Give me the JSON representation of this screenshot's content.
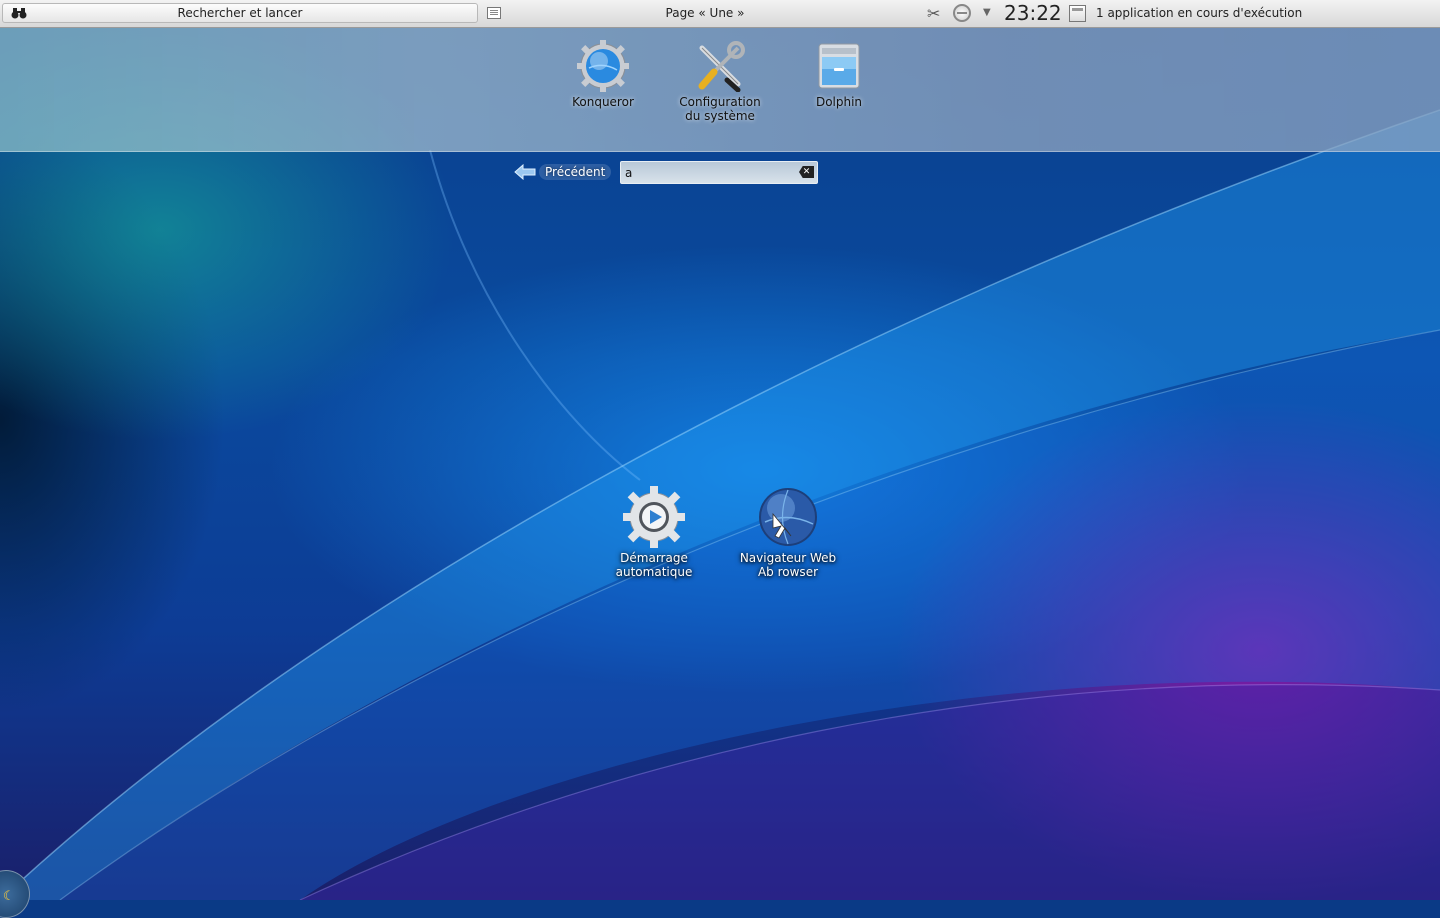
{
  "panel": {
    "search_label": "Rechercher et lancer",
    "page_label": "Page « Une »",
    "clock": "23:22",
    "running_apps": "1 application en cours d'exécution"
  },
  "favorites": [
    {
      "label": "Konqueror",
      "icon": "konqueror-gear-globe-icon"
    },
    {
      "label": "Configuration du système",
      "icon": "system-settings-tools-icon"
    },
    {
      "label": "Dolphin",
      "icon": "dolphin-file-cabinet-icon"
    }
  ],
  "search": {
    "back_label": "Précédent",
    "query": "a"
  },
  "results": [
    {
      "label": "Démarrage automatique",
      "icon": "autostart-gear-play-icon"
    },
    {
      "label": "Navigateur Web Ab rowser",
      "icon": "arora-browser-globe-icon"
    }
  ],
  "colors": {
    "panel": "#e4e4e4",
    "wallpaper_blue": "#0a4a9e",
    "wallpaper_purple": "#9614aa"
  }
}
